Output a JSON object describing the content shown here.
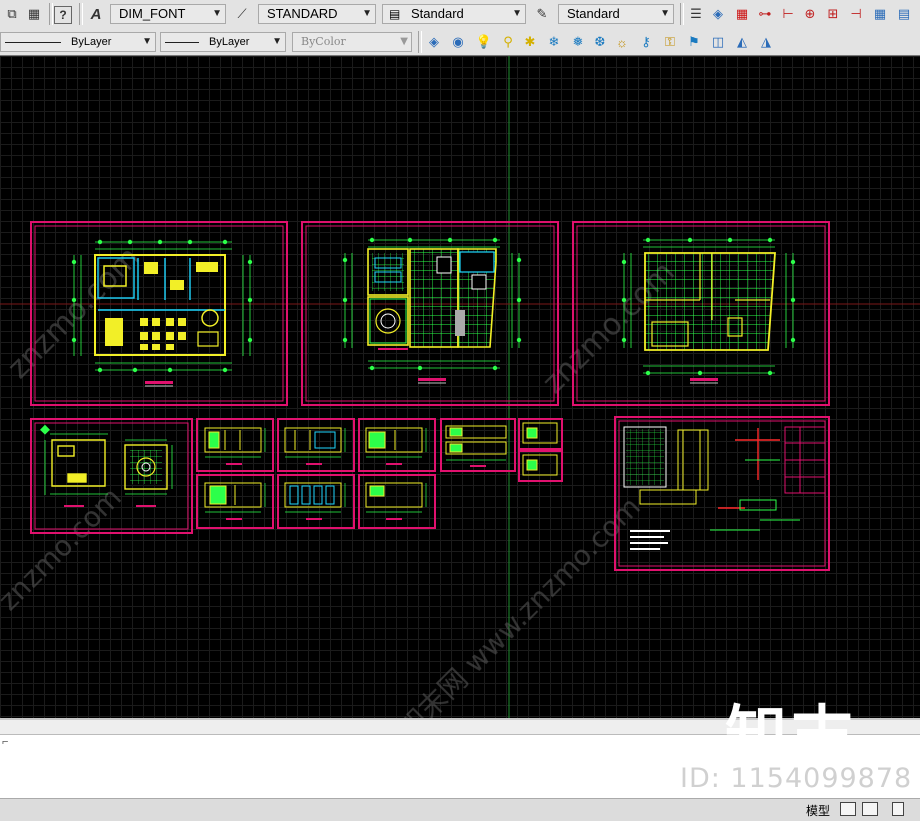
{
  "toolbar_top": {
    "text_style": "DIM_FONT",
    "dim_style": "STANDARD",
    "table_style": "Standard",
    "multileader_style": "Standard"
  },
  "toolbar_props": {
    "linetype": "ByLayer",
    "lineweight": "ByLayer",
    "plotstyle": "ByColor"
  },
  "status": {
    "model_tab": "模型"
  },
  "watermark": {
    "brand": "知末",
    "id": "ID: 1154099878",
    "site": "znzmo.com",
    "site_cn": "知末网 www.znzmo.com"
  },
  "colors": {
    "frame": "#e0116e",
    "drawing_green": "#2cff4a",
    "drawing_yellow": "#f2ef27",
    "drawing_cyan": "#1fd7ff",
    "grid": "#1b1b1b"
  }
}
